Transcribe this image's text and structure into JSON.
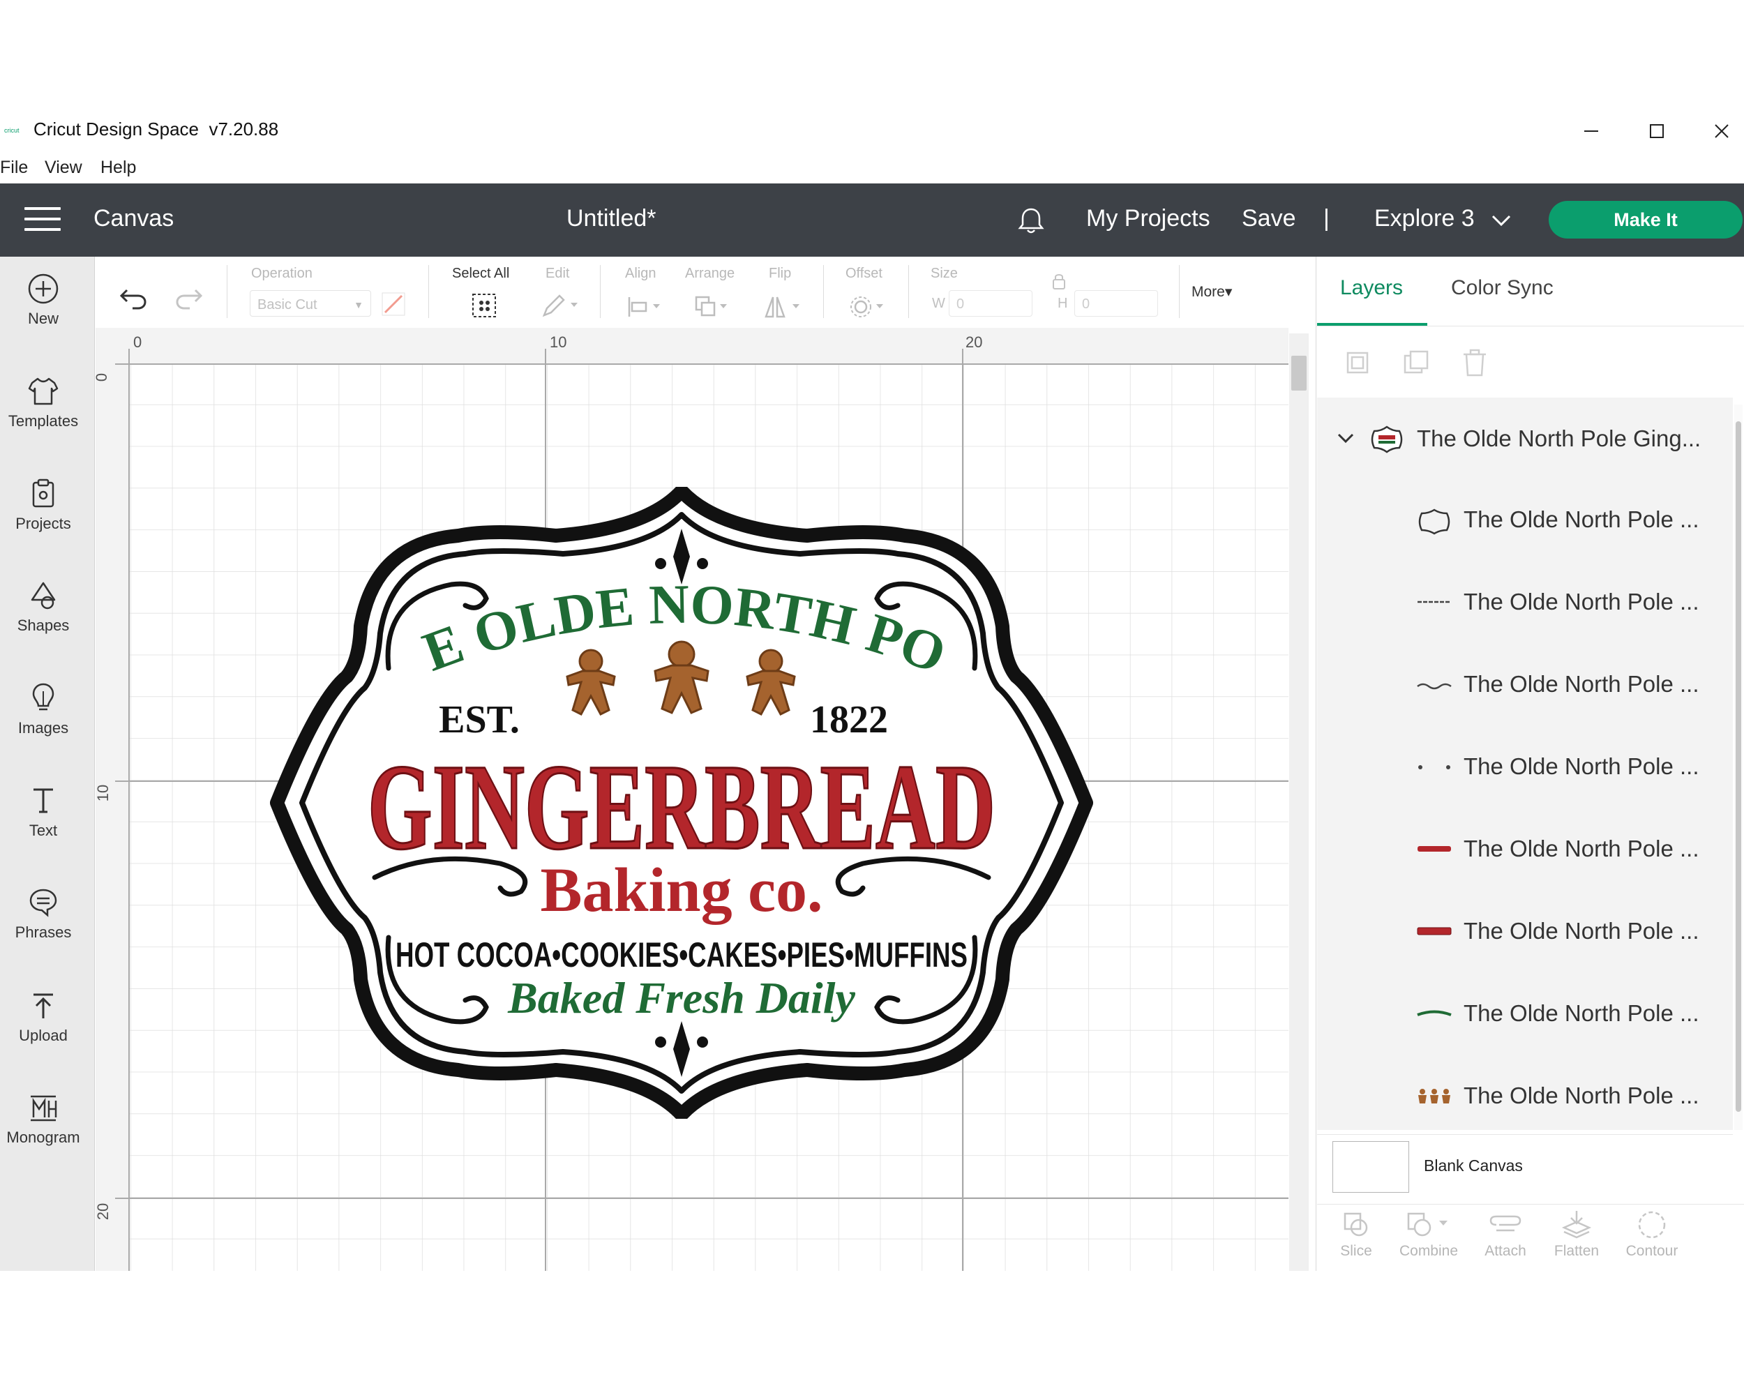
{
  "window": {
    "title": "Cricut Design Space  v7.20.88",
    "logo_text": "cricut",
    "controls": {
      "minimize": "—",
      "maximize": "☐",
      "close": "✕"
    }
  },
  "menu": [
    "File",
    "View",
    "Help"
  ],
  "header": {
    "section": "Canvas",
    "doc_title": "Untitled*",
    "my_projects": "My Projects",
    "save": "Save",
    "separator": "|",
    "machine": "Explore 3",
    "make_it": "Make It",
    "bg_color": "#3d4147",
    "accent_color": "#0b9e6d"
  },
  "sidebar": [
    {
      "label": "New",
      "icon": "plus-circle-icon"
    },
    {
      "label": "Templates",
      "icon": "shirt-icon"
    },
    {
      "label": "Projects",
      "icon": "clipboard-icon"
    },
    {
      "label": "Shapes",
      "icon": "shapes-icon"
    },
    {
      "label": "Images",
      "icon": "lightbulb-icon"
    },
    {
      "label": "Text",
      "icon": "text-icon"
    },
    {
      "label": "Phrases",
      "icon": "speech-bubble-icon"
    },
    {
      "label": "Upload",
      "icon": "upload-icon"
    },
    {
      "label": "Monogram",
      "icon": "monogram-icon"
    }
  ],
  "toolbar": {
    "operation_label": "Operation",
    "operation_value": "Basic Cut",
    "select_all": "Select All",
    "edit": "Edit",
    "align": "Align",
    "arrange": "Arrange",
    "flip": "Flip",
    "offset": "Offset",
    "size": "Size",
    "w_label": "W",
    "h_label": "H",
    "w_value": "0",
    "h_value": "0",
    "more": "More▾"
  },
  "canvas": {
    "ruler_top": [
      "0",
      "10",
      "20"
    ],
    "ruler_left": [
      "0",
      "10",
      "20"
    ],
    "design": {
      "line1": "THE OLDE NORTH POLE",
      "est": "EST.",
      "year": "1822",
      "main": "GINGERBREAD",
      "sub": "Baking co.",
      "items": "HOT COCOA•COOKIES•CAKES•PIES•MUFFINS",
      "tagline": "Baked Fresh Daily",
      "green": "#1f6b35",
      "red": "#b3262b",
      "brown": "#a5632e"
    }
  },
  "layers_panel": {
    "tabs": [
      "Layers",
      "Color Sync"
    ],
    "group": {
      "name": "The Olde North Pole Ging..."
    },
    "layers": [
      {
        "name": "The Olde North Pole ...",
        "thumb": "frame-thumb-icon"
      },
      {
        "name": "The Olde North Pole ...",
        "thumb": "line-thumb-icon"
      },
      {
        "name": "The Olde North Pole ...",
        "thumb": "script-thumb-icon"
      },
      {
        "name": "The Olde North Pole ...",
        "thumb": "dots-thumb-icon"
      },
      {
        "name": "The Olde North Pole ...",
        "thumb": "baking-thumb-icon"
      },
      {
        "name": "The Olde North Pole ...",
        "thumb": "gingerbread-thumb-icon"
      },
      {
        "name": "The Olde North Pole ...",
        "thumb": "green-text-thumb-icon"
      },
      {
        "name": "The Olde North Pole ...",
        "thumb": "cookies-thumb-icon"
      }
    ],
    "blank_canvas": "Blank Canvas",
    "bottom_tools": [
      "Slice",
      "Combine",
      "Attach",
      "Flatten",
      "Contour"
    ]
  }
}
